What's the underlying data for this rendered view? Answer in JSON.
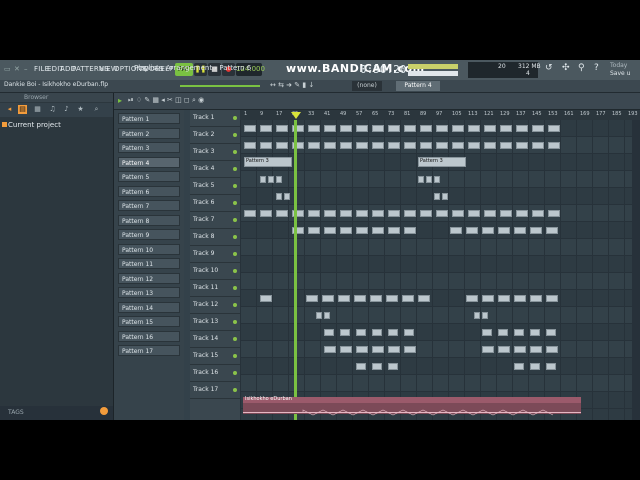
{
  "app": {
    "watermark": "www.BANDICAM.com",
    "time": "0:50:20",
    "file_title": "Dankie Boi - Isikhokho eDurban.flp",
    "tempo": "124.000",
    "menu": [
      "FILE",
      "EDIT",
      "ADD",
      "PATTERNS",
      "VIEW",
      "OPTIONS",
      "TOOLS",
      "HELP"
    ],
    "snap": "(none)",
    "pattern_selector": "Pattern 4",
    "cpu_value": "20",
    "mem_value": "312 MB",
    "poly_value": "4",
    "today_text": "Today",
    "save_text": "Save u",
    "accent": "#7ac142"
  },
  "browser": {
    "title": "Browser",
    "current_project": "Current project",
    "tags_label": "TAGS"
  },
  "playlist": {
    "title": "Playlist - Arrangement",
    "breadcrumb_sep": "›",
    "pattern": "Pattern 6"
  },
  "patterns": [
    "Pattern 1",
    "Pattern 2",
    "Pattern 3",
    "Pattern 4",
    "Pattern 5",
    "Pattern 6",
    "Pattern 7",
    "Pattern 8",
    "Pattern 9",
    "Pattern 10",
    "Pattern 11",
    "Pattern 12",
    "Pattern 13",
    "Pattern 14",
    "Pattern 15",
    "Pattern 16",
    "Pattern 17"
  ],
  "tracks": [
    "Track 1",
    "Track 2",
    "Track 3",
    "Track 4",
    "Track 5",
    "Track 6",
    "Track 7",
    "Track 8",
    "Track 9",
    "Track 10",
    "Track 11",
    "Track 12",
    "Track 13",
    "Track 14",
    "Track 15",
    "Track 16",
    "Track 17"
  ],
  "ruler_ticks": [
    "1",
    "9",
    "17",
    "25",
    "33",
    "41",
    "49",
    "57",
    "65",
    "73",
    "81",
    "89",
    "97",
    "105",
    "113",
    "121",
    "129",
    "137",
    "145",
    "153",
    "161",
    "169",
    "177",
    "185",
    "193"
  ],
  "clip_labels": {
    "track3_left": "Pattern 3",
    "track3_right": "Pattern 3",
    "audio": "Isikhokho eDurban"
  }
}
